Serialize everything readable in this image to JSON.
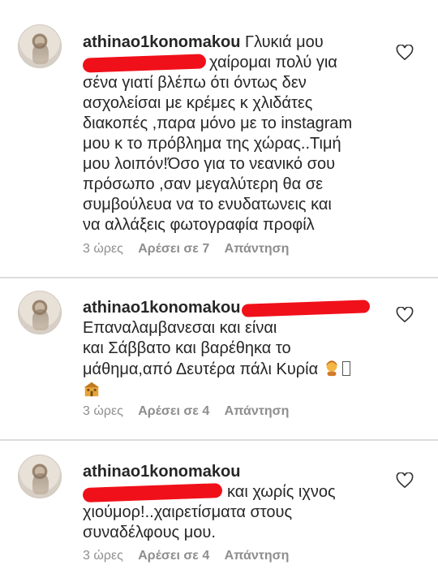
{
  "comments": [
    {
      "username": "athinao1konomakou",
      "lines": [
        "Γλυκιά μου",
        "χαίρομαι πολύ για",
        "σένα γιατί βλέπω ότι όντως δεν",
        "ασχολείσαι με κρέμες κ χλιδάτες",
        "διακοπές ,παρα μόνο με το instagram",
        "μου κ το πρόβλημα της χώρας..Τιμή",
        "μου λοιπόν!Όσο για το νεανικό σου",
        "πρόσωπο ,σαν μεγαλύτερη θα σε",
        "συμβούλευα να το ενυδατωνεις και",
        "να αλλάξεις φωτογραφία προφίλ"
      ],
      "time": "3 ώρες",
      "likes": "Αρέσει σε 7",
      "reply": "Απάντηση"
    },
    {
      "username": "athinao1konomakou",
      "lines": [
        "Επαναλαμβανεσαι και είναι",
        "και Σάββατο και βαρέθηκα το",
        "μάθημα,από Δευτέρα πάλι Κυρία"
      ],
      "time": "3 ώρες",
      "likes": "Αρέσει σε 4",
      "reply": "Απάντηση"
    },
    {
      "username": "athinao1konomakou",
      "lines": [
        "και χωρίς ιχνος",
        "χιούμορ!..χαιρετίσματα στους",
        "συναδέλφους μου."
      ],
      "time": "3 ώρες",
      "likes": "Αρέσει σε 4",
      "reply": "Απάντηση"
    }
  ],
  "icons": {
    "like": "heart-outline-icon",
    "emoji_1": "teacher-emoji-icon",
    "emoji_2": "school-emoji-icon"
  },
  "colors": {
    "text": "#262626",
    "meta": "#8e8e8e",
    "redaction": "#f0101a"
  }
}
